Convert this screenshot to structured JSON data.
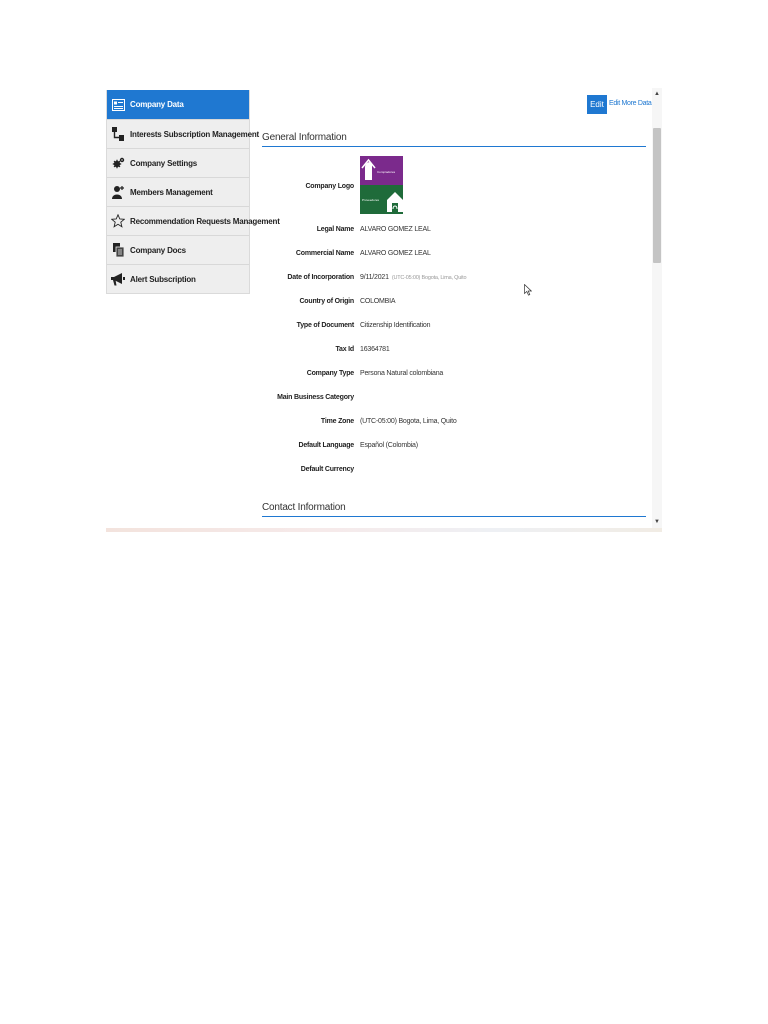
{
  "sidebar": {
    "items": [
      {
        "label": "Company Data",
        "icon": "company-data-icon",
        "active": true
      },
      {
        "label": "Interests Subscription Management",
        "icon": "hierarchy-icon"
      },
      {
        "label": "Company Settings",
        "icon": "gears-icon"
      },
      {
        "label": "Members Management",
        "icon": "add-user-icon"
      },
      {
        "label": "Recommendation Requests Management",
        "icon": "star-outline-icon"
      },
      {
        "label": "Company Docs",
        "icon": "documents-icon"
      },
      {
        "label": "Alert Subscription",
        "icon": "megaphone-icon"
      }
    ]
  },
  "toolbar": {
    "edit_label": "Edit",
    "edit_more_label": "Edit More Data"
  },
  "general": {
    "title": "General Information",
    "logo_label": "Company Logo",
    "logo_text_top": "Compradores",
    "logo_text_bottom": "Proveedores",
    "fields": [
      {
        "label": "Legal Name",
        "value": "ALVARO GOMEZ LEAL"
      },
      {
        "label": "Commercial Name",
        "value": "ALVARO GOMEZ LEAL"
      },
      {
        "label": "Date of Incorporation",
        "value": "9/11/2021",
        "sub": "(UTC-05:00) Bogota, Lima, Quito"
      },
      {
        "label": "Country of Origin",
        "value": "COLOMBIA"
      },
      {
        "label": "Type of Document",
        "value": "Citizenship Identification"
      },
      {
        "label": "Tax Id",
        "value": "16364781"
      },
      {
        "label": "Company Type",
        "value": "Persona Natural colombiana"
      },
      {
        "label": "Main Business Category",
        "value": ""
      },
      {
        "label": "Time Zone",
        "value": "(UTC-05:00) Bogota, Lima, Quito"
      },
      {
        "label": "Default Language",
        "value": "Español (Colombia)"
      },
      {
        "label": "Default Currency",
        "value": ""
      }
    ]
  },
  "contact": {
    "title": "Contact Information"
  },
  "colors": {
    "accent": "#1f78d1",
    "logo_purple": "#7b2a8c",
    "logo_green": "#1f6b3a"
  }
}
